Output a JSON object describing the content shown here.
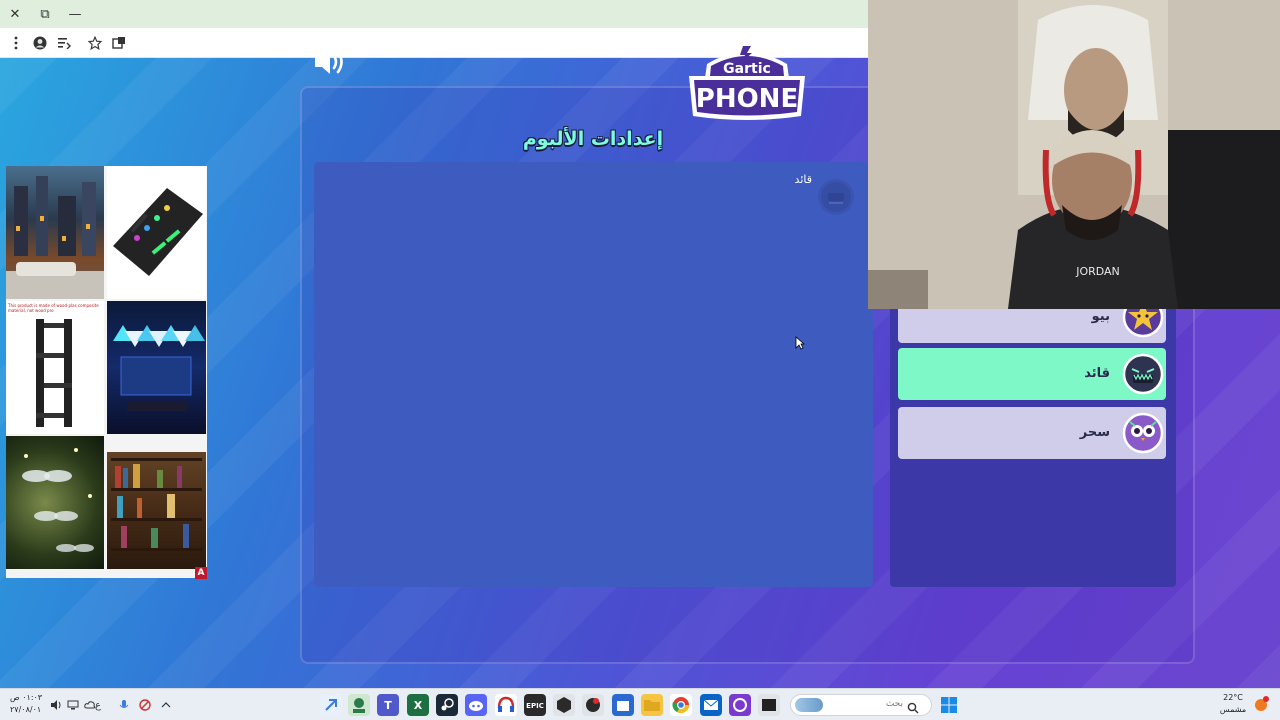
{
  "browser": {
    "window_controls": {
      "close": "✕",
      "restore": "⧉",
      "minimize": "—"
    },
    "toolbar": {
      "menu_icon": "kebab-menu-icon",
      "profile_icon": "profile-icon",
      "reading_list_icon": "reading-list-icon",
      "bookmark_icon": "star-icon",
      "extensions_icon": "extensions-icon"
    }
  },
  "game": {
    "sound_icon": "speaker-icon",
    "logo": {
      "line1": "Gartic",
      "line2": "PHONE"
    },
    "album_title": "إعدادات الألبوم",
    "album_owner": "قائد",
    "players": [
      {
        "name": "بيو",
        "active": false,
        "avatar": "yellow-star-avatar"
      },
      {
        "name": "قائد",
        "active": true,
        "avatar": "dark-monster-avatar"
      },
      {
        "name": "سحر",
        "active": false,
        "avatar": "owl-avatar"
      }
    ]
  },
  "ads": {
    "badge": "A",
    "tiles": [
      "city-street-image",
      "audio-mixer-image",
      "corner-shelf-image",
      "hexagon-lights-image",
      "dragonfly-decor-image",
      "bookshelf-image"
    ],
    "shelf_caption": "This product is made of wood-plas composite material, not wood pro"
  },
  "taskbar": {
    "clock_time": "٠١:٠٣ ص",
    "clock_date": "٢٧/٠٨/٠١",
    "search_placeholder": "بحث",
    "weather_temp": "22°C",
    "weather_desc": "مشمس",
    "input_lang": "ع"
  },
  "colors": {
    "accent_green": "#7ff8c7",
    "title_text": "#7dfbe1",
    "panel_blue": "#3e5cc0",
    "panel_purple": "#3d38a8"
  }
}
